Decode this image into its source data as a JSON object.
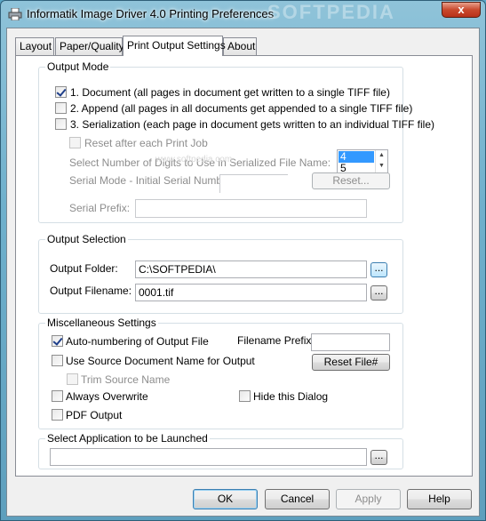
{
  "window": {
    "title": "Informatik Image Driver 4.0 Printing Preferences",
    "watermark": "SOFTPEDIA",
    "close_label": "x"
  },
  "tabs": [
    {
      "label": "Layout"
    },
    {
      "label": "Paper/Quality"
    },
    {
      "label": "Print Output Settings",
      "active": true
    },
    {
      "label": "About"
    }
  ],
  "output_mode": {
    "title": "Output Mode",
    "document": {
      "label": "1. Document (all pages in document get written to a single TIFF file)",
      "checked": true
    },
    "append": {
      "label": "2. Append (all pages in all documents get appended to a single TIFF file)",
      "checked": false
    },
    "serialization": {
      "label": "3. Serialization (each page in document gets written to an individual TIFF file)",
      "checked": false
    },
    "reset_each_job": {
      "label": "Reset after each Print Job",
      "checked": false
    },
    "digits_label": "Select Number of Digits to Use in Serialized File Name:",
    "digits_options": [
      "4",
      "5"
    ],
    "serial_mode_label": "Serial Mode - Initial Serial Number:",
    "serial_number_value": "",
    "reset_button": "Reset...",
    "serial_prefix_label": "Serial Prefix:",
    "serial_prefix_value": ""
  },
  "watermark_center": "www.softpedia.com",
  "output_selection": {
    "title": "Output Selection",
    "folder_label": "Output Folder:",
    "folder_value": "C:\\SOFTPEDIA\\",
    "filename_label": "Output Filename:",
    "filename_value": "0001.tif",
    "browse_label": "..."
  },
  "misc": {
    "title": "Miscellaneous Settings",
    "auto_numbering": {
      "label": "Auto-numbering of Output File",
      "checked": true
    },
    "use_source_name": {
      "label": "Use Source Document Name for Output",
      "checked": false
    },
    "trim_source_name": {
      "label": "Trim Source Name",
      "checked": false
    },
    "always_overwrite": {
      "label": "Always Overwrite",
      "checked": false
    },
    "pdf_output": {
      "label": "PDF Output",
      "checked": false
    },
    "hide_dialog": {
      "label": "Hide this Dialog",
      "checked": false
    },
    "filename_prefix_label": "Filename Prefix:",
    "filename_prefix_value": "",
    "reset_file_button": "Reset File#"
  },
  "launch": {
    "title": "Select Application to be Launched",
    "value": "",
    "browse_label": "..."
  },
  "buttons": {
    "ok": "OK",
    "cancel": "Cancel",
    "apply": "Apply",
    "help": "Help"
  },
  "colors": {
    "selection": "#3399ff",
    "close_button": "#c9492d"
  }
}
